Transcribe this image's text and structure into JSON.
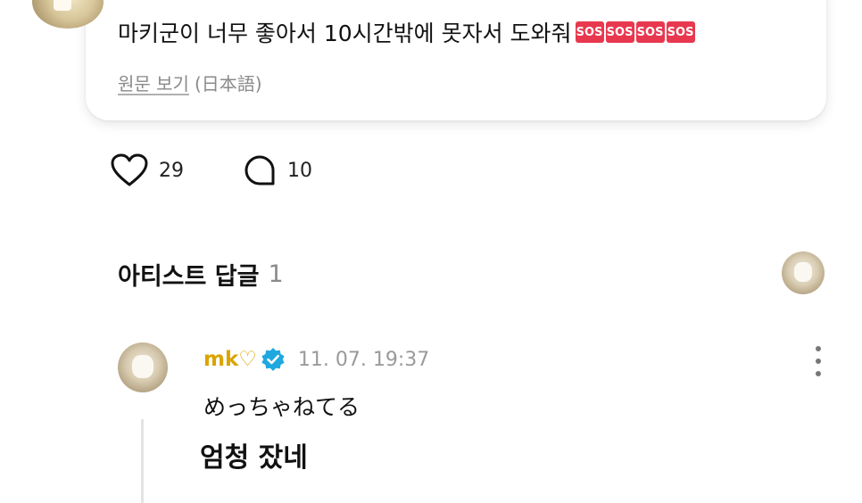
{
  "post": {
    "text": "마키군이 너무 좋아서 10시간밖에 못자서 도와줘",
    "emoji_badges": [
      "SOS",
      "SOS",
      "SOS",
      "SOS"
    ],
    "view_original_label": "원문 보기",
    "original_language_label": "(日本語)"
  },
  "actions": {
    "like_count": "29",
    "comment_count": "10"
  },
  "artist_replies": {
    "title": "아티스트 답글",
    "count": "1"
  },
  "reply": {
    "author": "mk♡",
    "timestamp": "11. 07. 19:37",
    "body": "めっちゃねてる",
    "translation": "엄청 잤네"
  },
  "colors": {
    "author": "#d9a400",
    "verified": "#1fa8e0",
    "sos_badge": "#e8384f"
  },
  "icons": [
    "heart-icon",
    "comment-icon",
    "verified-icon",
    "more-options-icon"
  ]
}
